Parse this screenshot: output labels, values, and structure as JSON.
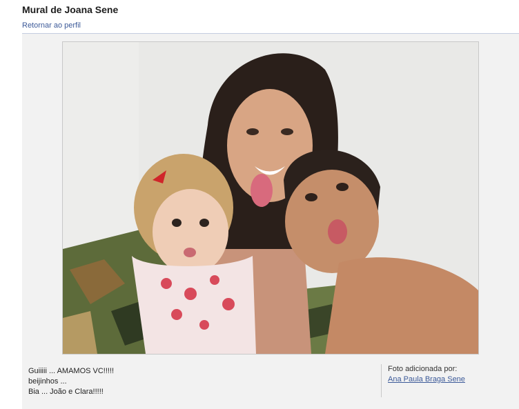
{
  "header": {
    "title": "Mural de Joana Sene",
    "back_link": "Retornar ao perfil"
  },
  "photo": {
    "caption_lines": [
      "Guiiiii ... AMAMOS VC!!!!!",
      "beijinhos ...",
      "Bia ... João e Clara!!!!!"
    ],
    "added_by_label": "Foto adicionada por:",
    "added_by_name": "Ana Paula Braga Sene"
  },
  "colors": {
    "link": "#3b5998",
    "panel_background": "#f2f2f2"
  }
}
